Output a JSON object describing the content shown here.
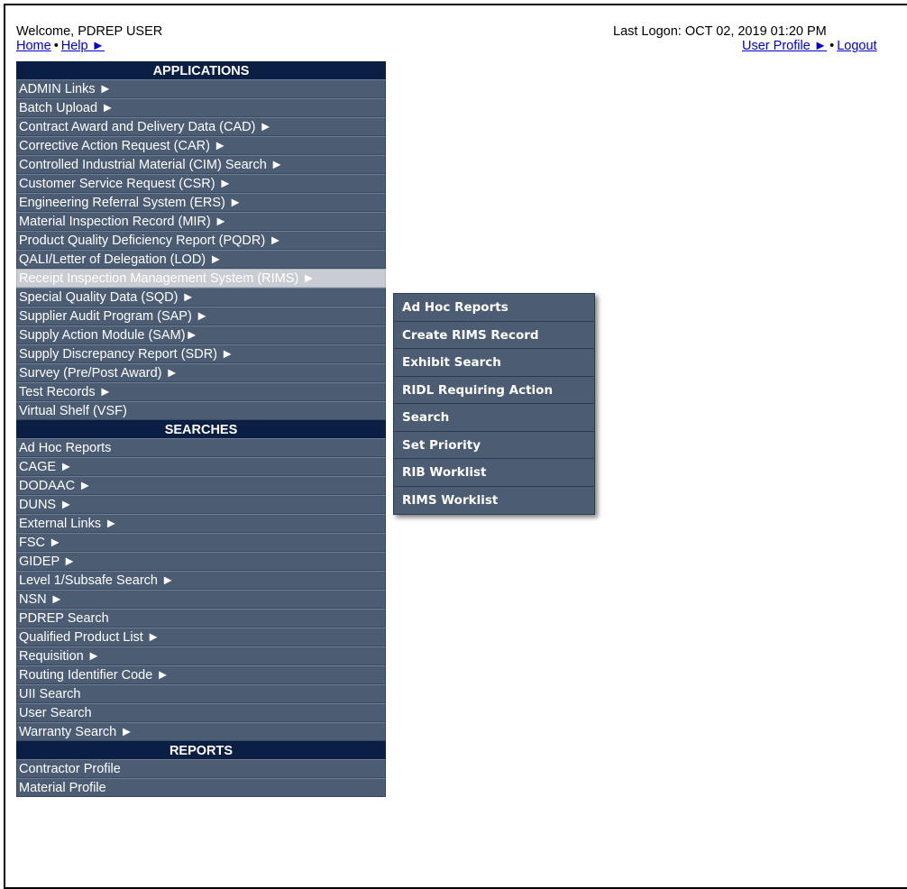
{
  "header": {
    "welcome": "Welcome, PDREP USER",
    "home_link": "Home",
    "help_link": "Help ►",
    "last_logon": "Last Logon: OCT 02, 2019 01:20 PM",
    "user_profile_link": "User Profile ►",
    "logout_link": "Logout"
  },
  "menu": {
    "applications_header": "APPLICATIONS",
    "applications": [
      "ADMIN Links ►",
      "Batch Upload ►",
      "Contract Award and Delivery Data (CAD) ►",
      "Corrective Action Request (CAR) ►",
      "Controlled Industrial Material (CIM) Search ►",
      "Customer Service Request (CSR) ►",
      "Engineering Referral System (ERS) ►",
      "Material Inspection Record (MIR) ►",
      "Product Quality Deficiency Report (PQDR) ►",
      "QALI/Letter of Delegation (LOD) ►",
      "Receipt Inspection Management System (RIMS) ►",
      "Special Quality Data (SQD) ►",
      "Supplier Audit Program (SAP) ►",
      "Supply Action Module (SAM)►",
      "Supply Discrepancy Report (SDR) ►",
      "Survey (Pre/Post Award) ►",
      "Test Records ►",
      "Virtual Shelf (VSF)"
    ],
    "searches_header": "SEARCHES",
    "searches": [
      "Ad Hoc Reports",
      "CAGE ►",
      "DODAAC ►",
      "DUNS ►",
      "External Links ►",
      "FSC ►",
      "GIDEP ►",
      "Level 1/Subsafe Search ►",
      "NSN ►",
      "PDREP Search",
      "Qualified Product List ►",
      "Requisition ►",
      "Routing Identifier Code ►",
      "UII Search",
      "User Search",
      "Warranty Search  ►"
    ],
    "reports_header": "REPORTS",
    "reports": [
      "Contractor Profile",
      "Material Profile"
    ]
  },
  "rims_submenu": [
    "Ad Hoc Reports",
    "Create RIMS Record",
    "Exhibit Search",
    "RIDL Requiring Action",
    "Search",
    "Set Priority",
    "RIB Worklist",
    "RIMS Worklist"
  ],
  "colors": {
    "menu_item_bg": "#4b5c73",
    "menu_header_bg": "#0b1f44",
    "active_item_bg": "#c9cdd3",
    "link": "#0000cc"
  }
}
